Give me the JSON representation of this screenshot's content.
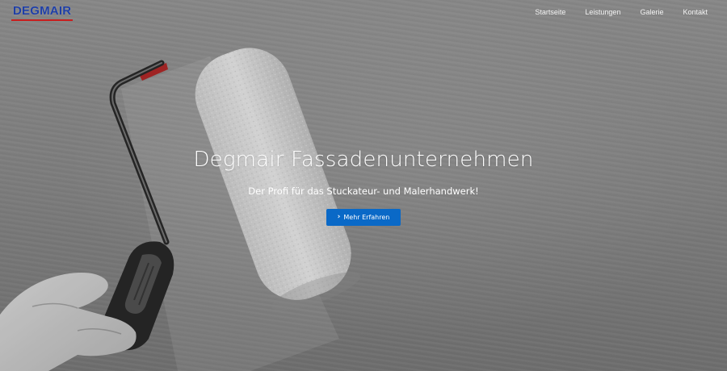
{
  "brand": {
    "logo_text": "DEGMAIR",
    "logo_color": "#1f3fa6",
    "logo_underline_color": "#c81e1e"
  },
  "nav": {
    "items": [
      {
        "label": "Startseite"
      },
      {
        "label": "Leistungen"
      },
      {
        "label": "Galerie"
      },
      {
        "label": "Kontakt"
      }
    ]
  },
  "hero": {
    "title": "Degmair Fassadenunternehmen",
    "subtitle": "Der Profi für das Stuckateur- und Malerhandwerk!",
    "cta_icon": "chevron-right-icon",
    "cta_glyph": "›",
    "cta_label": "Mehr Erfahren",
    "cta_color": "#0a69c7",
    "background_image": "paint-roller-on-white-wall"
  }
}
